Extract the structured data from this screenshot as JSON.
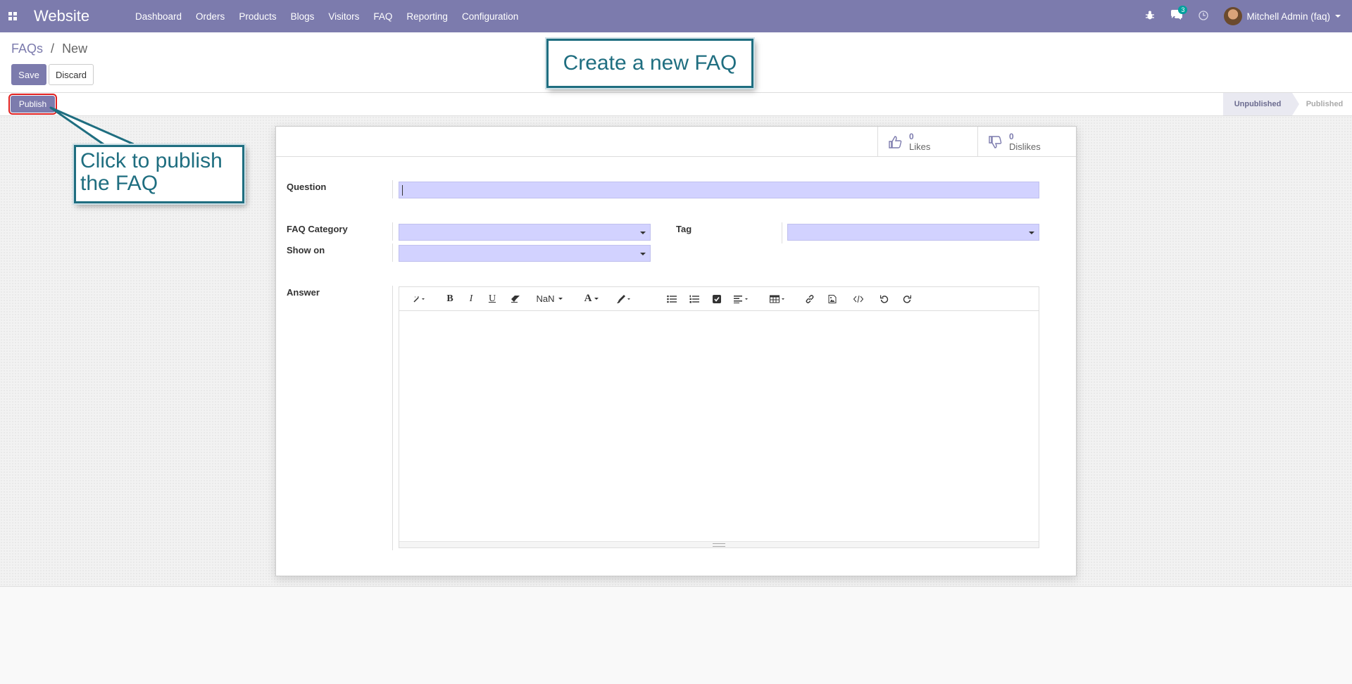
{
  "topbar": {
    "app_title": "Website",
    "menu": [
      "Dashboard",
      "Orders",
      "Products",
      "Blogs",
      "Visitors",
      "FAQ",
      "Reporting",
      "Configuration"
    ],
    "messages_count": "3",
    "user_name": "Mitchell Admin (faq)"
  },
  "breadcrumb": {
    "parent": "FAQs",
    "separator": "/",
    "current": "New"
  },
  "buttons": {
    "save": "Save",
    "discard": "Discard",
    "publish": "Publish"
  },
  "status": {
    "stages": [
      "Unpublished",
      "Published"
    ],
    "current": "Unpublished"
  },
  "stats": {
    "likes": {
      "value": "0",
      "label": "Likes"
    },
    "dislikes": {
      "value": "0",
      "label": "Dislikes"
    }
  },
  "form": {
    "question_label": "Question",
    "question_value": "",
    "category_label": "FAQ Category",
    "tag_label": "Tag",
    "show_on_label": "Show on",
    "answer_label": "Answer"
  },
  "editor": {
    "font_size": "NaN",
    "bold": "B",
    "italic": "I",
    "underline": "U",
    "font_color": "A"
  },
  "callouts": {
    "title": "Create a new FAQ",
    "publish_hint": "Click to publish the FAQ"
  },
  "colors": {
    "brand": "#7c7bad",
    "callout": "#1f6e80",
    "field": "#d2d2ff",
    "highlight": "#e02020"
  }
}
